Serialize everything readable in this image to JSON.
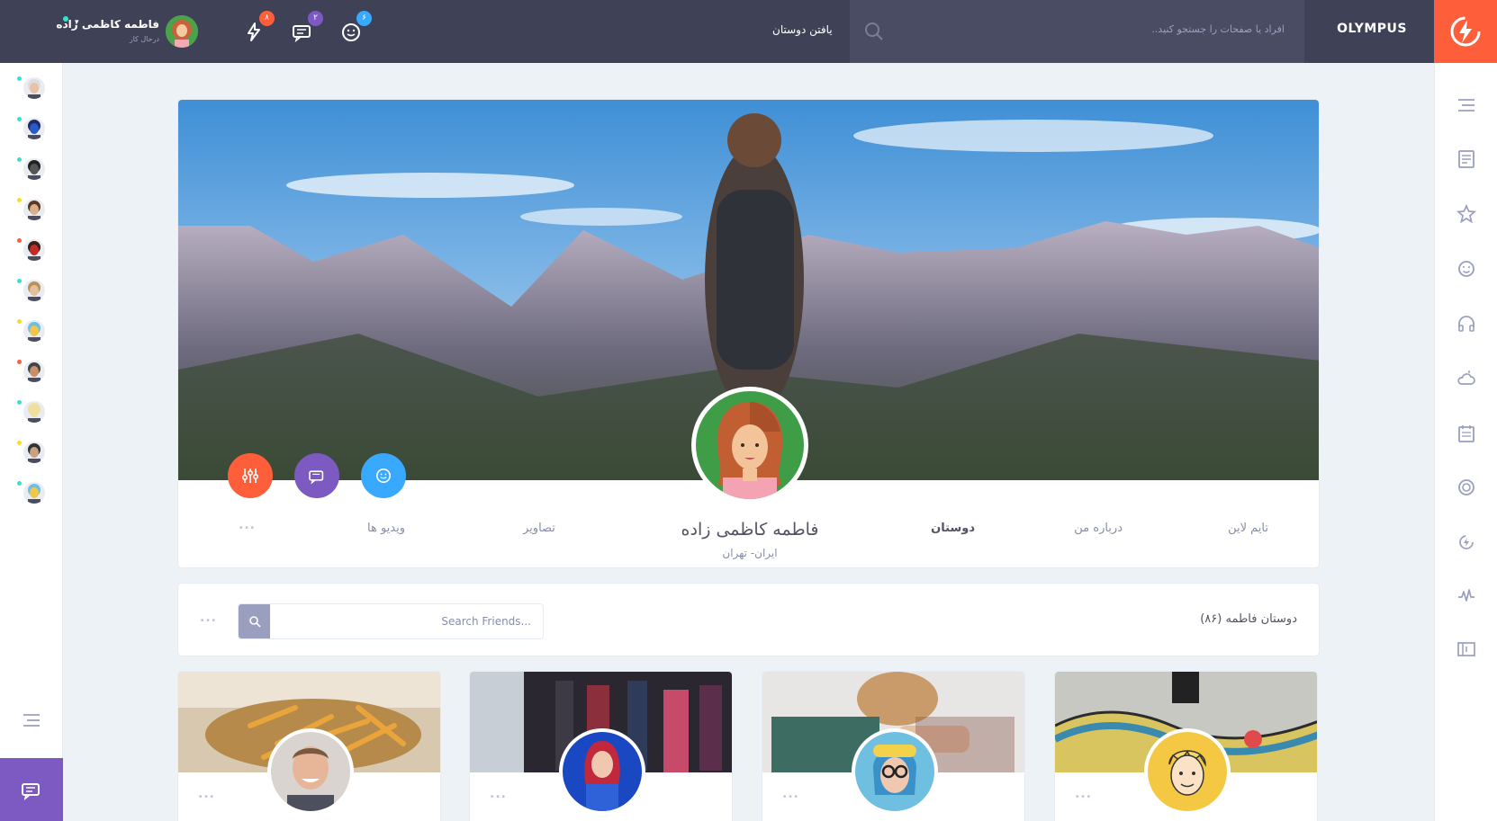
{
  "topbar": {
    "brand": "OLYMPUS",
    "search_placeholder": "افراد یا صفحات را جستجو کنید..",
    "find_friends": "یافتن دوستان",
    "badges": {
      "friend_requests": "۶",
      "messages": "۲",
      "notifications": "۸"
    },
    "user_name": "فاطمه کاظمی زاده",
    "user_status": "درحال کار",
    "colors": {
      "bar": "#3f4257",
      "accent": "#ff5e3a",
      "badge_blue": "#38a9ff",
      "badge_purple": "#7c5ac2",
      "badge_orange": "#ff5e3a"
    }
  },
  "right_sidebar": {
    "icons": [
      "menu-icon",
      "newsfeed-icon",
      "star-icon",
      "smile-icon",
      "headphones-icon",
      "weather-icon",
      "calendar-icon",
      "badge-icon",
      "thunder-icon",
      "stats-icon",
      "manage-widgets-icon"
    ]
  },
  "left_sidebar": {
    "avatars": [
      {
        "status": "online",
        "color": "#32e4cd"
      },
      {
        "status": "online",
        "color": "#32e4cd"
      },
      {
        "status": "online",
        "color": "#32e4cd"
      },
      {
        "status": "away",
        "color": "#ffdc1b"
      },
      {
        "status": "offline",
        "color": "#ff5e3a"
      },
      {
        "status": "online",
        "color": "#32e4cd"
      },
      {
        "status": "away",
        "color": "#ffdc1b"
      },
      {
        "status": "offline",
        "color": "#ff5e3a"
      },
      {
        "status": "online",
        "color": "#32e4cd"
      },
      {
        "status": "away",
        "color": "#ffdc1b"
      },
      {
        "status": "online",
        "color": "#32e4cd"
      }
    ]
  },
  "profile": {
    "name": "فاطمه کاظمی زاده",
    "location": "ایران- تهران",
    "nav": {
      "timeline": "تایم لاین",
      "about": "درباره من",
      "friends": "دوستان",
      "photos": "تصاویر",
      "videos": "ویدیو ها",
      "more": "..."
    },
    "buttons": [
      "friend-request-button",
      "message-button",
      "settings-button"
    ]
  },
  "friends_section": {
    "title": "دوستان فاطمه (۸۶)",
    "search_placeholder": "Search Friends...",
    "more": "..."
  },
  "friend_cards": [
    {
      "more": "..."
    },
    {
      "more": "..."
    },
    {
      "more": "..."
    },
    {
      "more": "..."
    }
  ]
}
